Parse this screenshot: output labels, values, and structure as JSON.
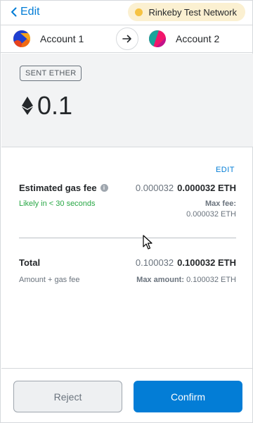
{
  "header": {
    "back_label": "Edit",
    "network_label": "Rinkeby Test Network",
    "network_color": "#f6c343"
  },
  "accounts": {
    "from_name": "Account 1",
    "to_name": "Account 2",
    "arrow_icon": "arrow-right-icon"
  },
  "summary": {
    "badge": "SENT ETHER",
    "amount": "0.1",
    "currency_icon": "ethereum-icon"
  },
  "details": {
    "edit_label": "EDIT",
    "gas_label": "Estimated gas fee",
    "gas_secondary": "0.000032",
    "gas_primary": "0.000032 ETH",
    "likely_text": "Likely in < 30 seconds",
    "max_fee_label": "Max fee:",
    "max_fee_value": "0.000032 ETH",
    "total_label": "Total",
    "total_secondary": "0.100032",
    "total_primary": "0.100032 ETH",
    "amount_gas_label": "Amount + gas fee",
    "max_amount_label": "Max amount:",
    "max_amount_value": "0.100032 ETH"
  },
  "footer": {
    "reject_label": "Reject",
    "confirm_label": "Confirm"
  },
  "colors": {
    "accent": "#037dd6",
    "success": "#28a745",
    "network_pill_bg": "#fbf0d1"
  }
}
